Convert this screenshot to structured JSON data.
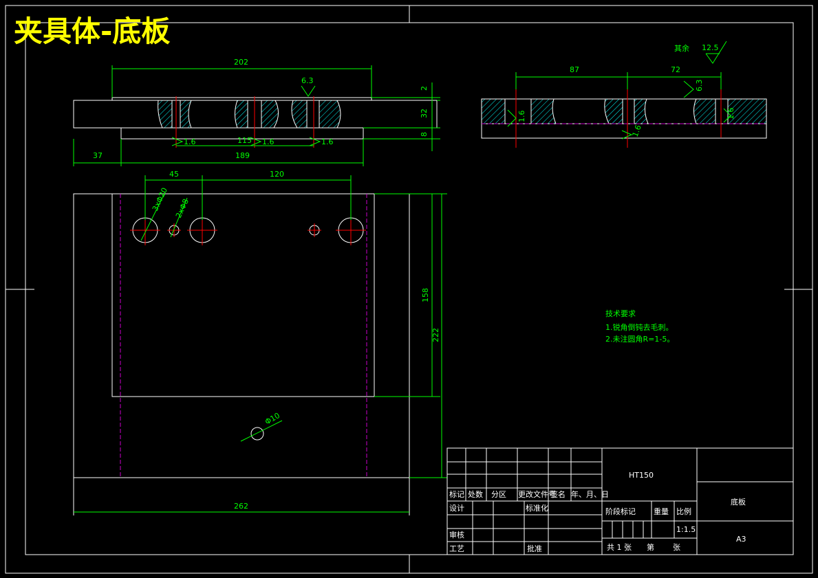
{
  "title": "夹具体-底板",
  "dims": {
    "d202": "202",
    "d2": "2",
    "d32": "32",
    "d8": "8",
    "d37": "37",
    "d189": "189",
    "d115": "115",
    "d45": "45",
    "d120": "120",
    "d158": "158",
    "d222": "222",
    "d262": "262",
    "d87": "87",
    "d72": "72",
    "hole1": "3xΦ20",
    "hole2": "2xΦ8",
    "hole3": "Φ10"
  },
  "roughness": {
    "r63a": "6.3",
    "r16a": "1.6",
    "r16b": "1.6",
    "r16c": "1.6",
    "r125": "12.5",
    "r125_label": "其余",
    "r63b": "6.3",
    "r16d": "1.6",
    "r16e": "1.6",
    "r16f": "1.6"
  },
  "notes": {
    "heading": "技术要求",
    "n1": "1.锐角倒钝去毛刺。",
    "n2": "2.未注圆角R=1-5。"
  },
  "titleblock": {
    "material": "HT150",
    "part_name": "底板",
    "size": "A3",
    "scale": "1:1.5",
    "h_mark": "标记",
    "h_count": "处数",
    "h_zone": "分区",
    "h_doc": "更改文件号",
    "h_sign": "签名",
    "h_date": "年、月、日",
    "design": "设计",
    "standard": "标准化",
    "stage": "阶段标记",
    "weight": "重量",
    "ratio": "比例",
    "check": "审核",
    "process": "工艺",
    "approve": "批准",
    "sheets": "共 1 张",
    "sheet_no": "第",
    "sheet_unit": "张"
  }
}
